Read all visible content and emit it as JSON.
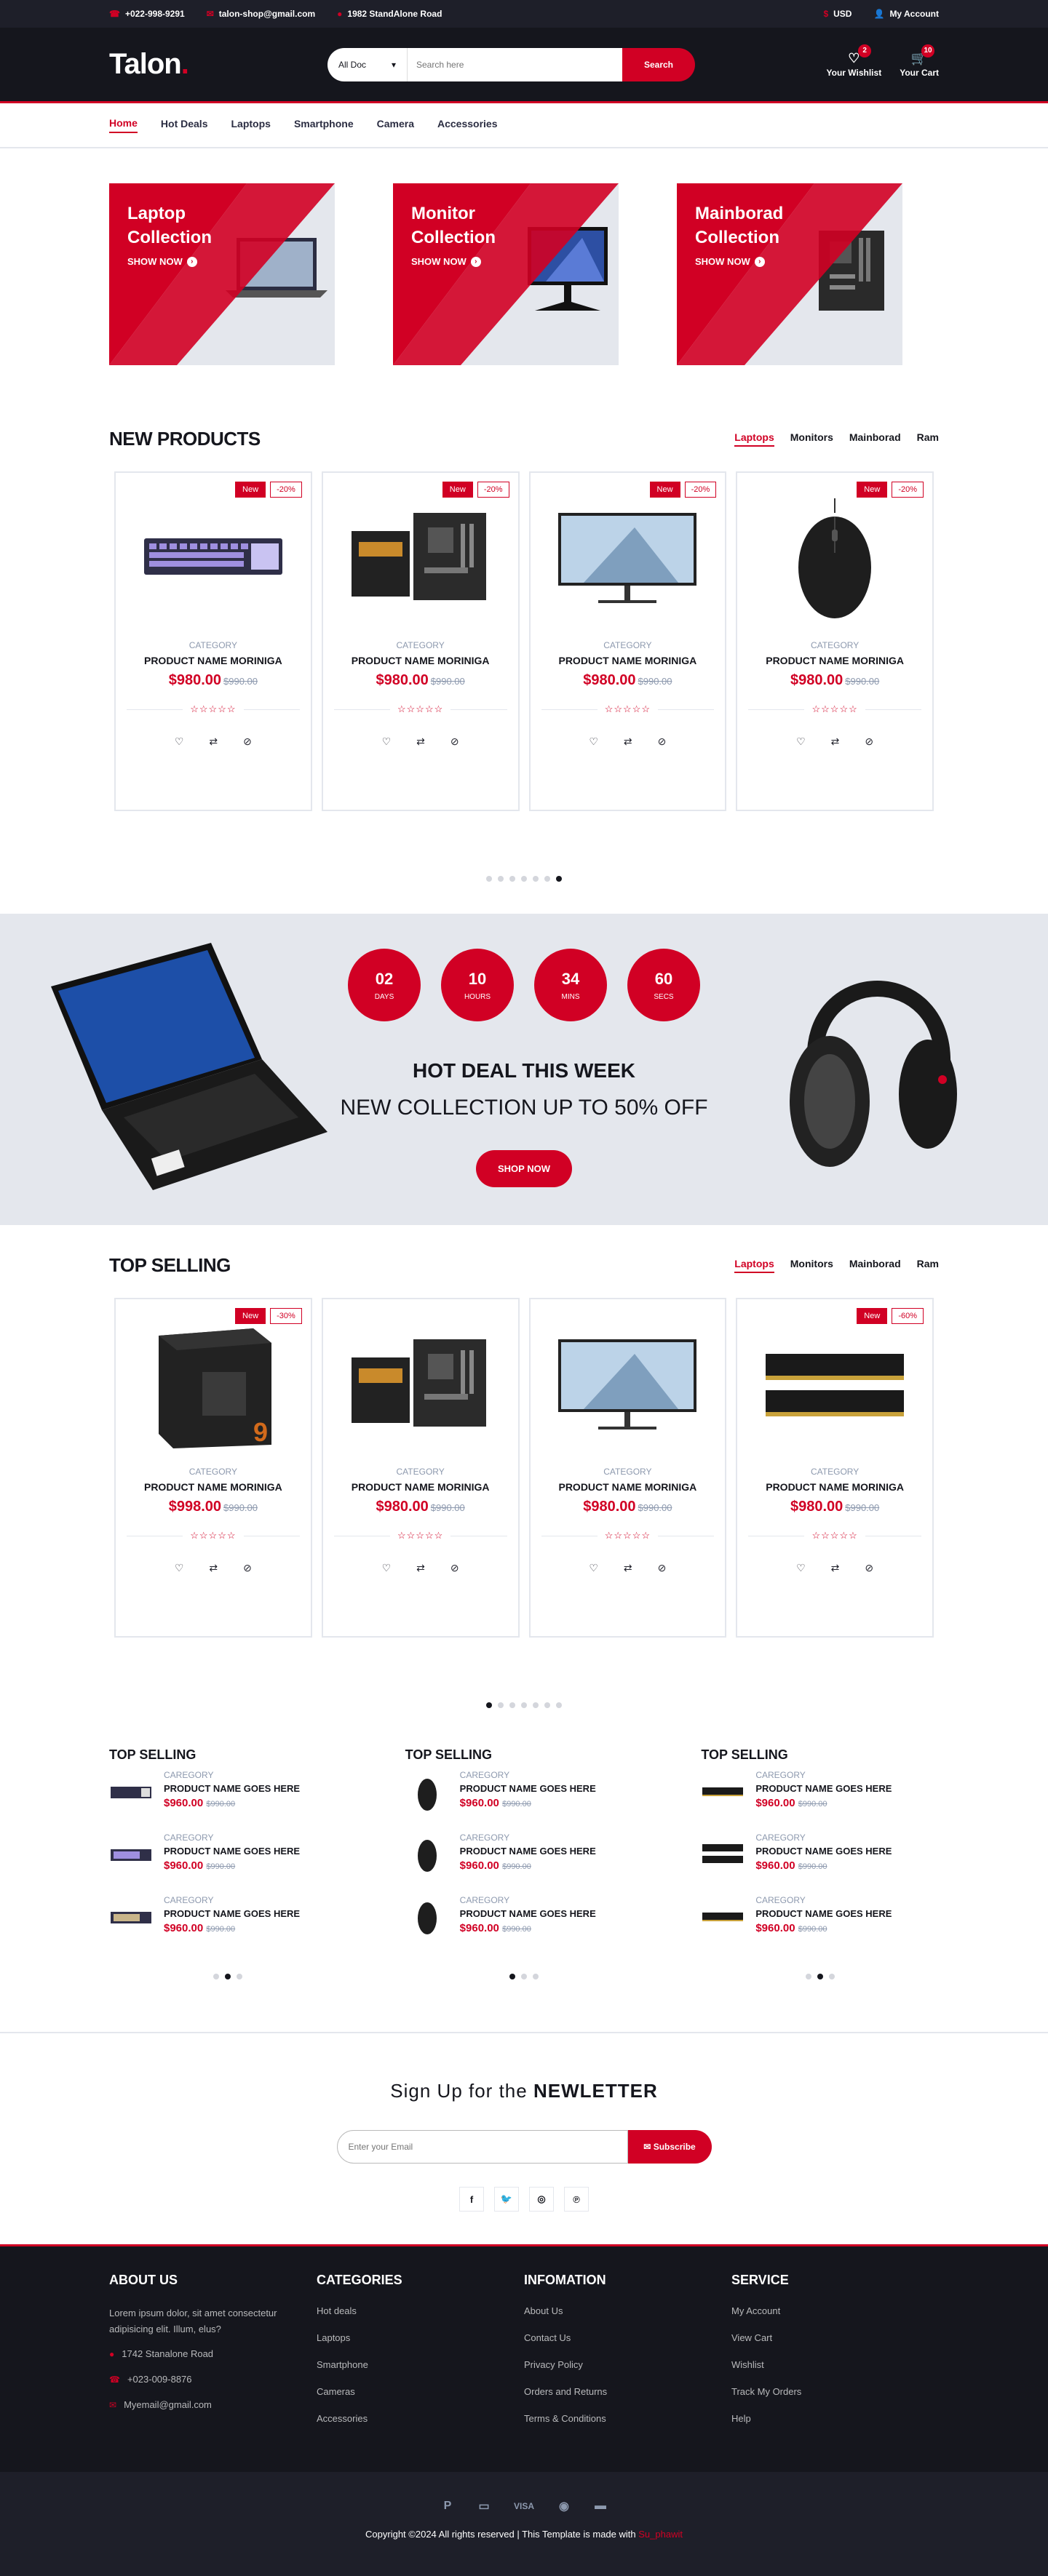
{
  "topbar": {
    "phone": "+022-998-9291",
    "email": "talon-shop@gmail.com",
    "address": "1982 StandAlone Road",
    "currency": "USD",
    "account": "My Account"
  },
  "header": {
    "logo": "Talon",
    "logo_dot": ".",
    "category_select": "All Doc",
    "search_placeholder": "Search here",
    "search_button": "Search",
    "wishlist_label": "Your Wishlist",
    "wishlist_count": "2",
    "cart_label": "Your Cart",
    "cart_count": "10"
  },
  "nav": [
    "Home",
    "Hot Deals",
    "Laptops",
    "Smartphone",
    "Camera",
    "Accessories"
  ],
  "collections": [
    {
      "title": "Laptop Collection",
      "cta": "SHOW NOW"
    },
    {
      "title": "Monitor Collection",
      "cta": "SHOW NOW"
    },
    {
      "title": "Mainborad Collection",
      "cta": "SHOW NOW"
    }
  ],
  "new_products": {
    "title": "NEW PRODUCTS",
    "tabs": [
      "Laptops",
      "Monitors",
      "Mainborad",
      "Ram"
    ],
    "items": [
      {
        "new": "New",
        "sale": "-20%",
        "category": "CATEGORY",
        "name": "PRODUCT NAME MORINIGA",
        "price": "$980.00",
        "old": "$990.00"
      },
      {
        "new": "New",
        "sale": "-20%",
        "category": "CATEGORY",
        "name": "PRODUCT NAME MORINIGA",
        "price": "$980.00",
        "old": "$990.00"
      },
      {
        "new": "New",
        "sale": "-20%",
        "category": "CATEGORY",
        "name": "PRODUCT NAME MORINIGA",
        "price": "$980.00",
        "old": "$990.00"
      },
      {
        "new": "New",
        "sale": "-20%",
        "category": "CATEGORY",
        "name": "PRODUCT NAME MORINIGA",
        "price": "$980.00",
        "old": "$990.00"
      }
    ]
  },
  "hot_deal": {
    "countdown": [
      {
        "value": "02",
        "unit": "DAYS"
      },
      {
        "value": "10",
        "unit": "HOURS"
      },
      {
        "value": "34",
        "unit": "MINS"
      },
      {
        "value": "60",
        "unit": "SECS"
      }
    ],
    "title": "HOT DEAL THIS WEEK",
    "subtitle": "NEW COLLECTION UP TO 50% OFF",
    "button": "SHOP NOW"
  },
  "top_selling": {
    "title": "TOP SELLING",
    "tabs": [
      "Laptops",
      "Monitors",
      "Mainborad",
      "Ram"
    ],
    "items": [
      {
        "new": "New",
        "sale": "-30%",
        "category": "CATEGORY",
        "name": "PRODUCT NAME MORINIGA",
        "price": "$998.00",
        "old": "$990.00"
      },
      {
        "new": "",
        "sale": "",
        "category": "CATEGORY",
        "name": "PRODUCT NAME MORINIGA",
        "price": "$980.00",
        "old": "$990.00"
      },
      {
        "new": "",
        "sale": "",
        "category": "CATEGORY",
        "name": "PRODUCT NAME MORINIGA",
        "price": "$980.00",
        "old": "$990.00"
      },
      {
        "new": "New",
        "sale": "-60%",
        "category": "CATEGORY",
        "name": "PRODUCT NAME MORINIGA",
        "price": "$980.00",
        "old": "$990.00"
      }
    ]
  },
  "widgets": [
    {
      "title": "TOP SELLING",
      "items": [
        {
          "category": "CAREGORY",
          "name": "PRODUCT NAME GOES HERE",
          "price": "$960.00",
          "old": "$990.00"
        },
        {
          "category": "CAREGORY",
          "name": "PRODUCT NAME GOES HERE",
          "price": "$960.00",
          "old": "$990.00"
        },
        {
          "category": "CAREGORY",
          "name": "PRODUCT NAME GOES HERE",
          "price": "$960.00",
          "old": "$990.00"
        }
      ]
    },
    {
      "title": "TOP SELLING",
      "items": [
        {
          "category": "CAREGORY",
          "name": "PRODUCT NAME GOES HERE",
          "price": "$960.00",
          "old": "$990.00"
        },
        {
          "category": "CAREGORY",
          "name": "PRODUCT NAME GOES HERE",
          "price": "$960.00",
          "old": "$990.00"
        },
        {
          "category": "CAREGORY",
          "name": "PRODUCT NAME GOES HERE",
          "price": "$960.00",
          "old": "$990.00"
        }
      ]
    },
    {
      "title": "TOP SELLING",
      "items": [
        {
          "category": "CAREGORY",
          "name": "PRODUCT NAME GOES HERE",
          "price": "$960.00",
          "old": "$990.00"
        },
        {
          "category": "CAREGORY",
          "name": "PRODUCT NAME GOES HERE",
          "price": "$960.00",
          "old": "$990.00"
        },
        {
          "category": "CAREGORY",
          "name": "PRODUCT NAME GOES HERE",
          "price": "$960.00",
          "old": "$990.00"
        }
      ]
    }
  ],
  "newsletter": {
    "title_prefix": "Sign Up for the",
    "title_bold": "NEWLETTER",
    "placeholder": "Enter your Email",
    "button": "Subscribe",
    "socials": [
      "f",
      "t",
      "ig",
      "p"
    ]
  },
  "footer": {
    "about": {
      "title": "ABOUT US",
      "text": "Lorem ipsum dolor, sit amet consectetur adipisicing elit. Illum, elus?",
      "address": "1742 Stanalone Road",
      "phone": "+023-009-8876",
      "email": "Myemail@gmail.com"
    },
    "categories": {
      "title": "CATEGORIES",
      "links": [
        "Hot deals",
        "Laptops",
        "Smartphone",
        "Cameras",
        "Accessories"
      ]
    },
    "information": {
      "title": "INFOMATION",
      "links": [
        "About Us",
        "Contact Us",
        "Privacy Policy",
        "Orders and Returns",
        "Terms & Conditions"
      ]
    },
    "service": {
      "title": "SERVICE",
      "links": [
        "My Account",
        "View Cart",
        "Wishlist",
        "Track My Orders",
        "Help"
      ]
    }
  },
  "bottom": {
    "payments": [
      "paypal-icon",
      "credit-card-icon",
      "VISA",
      "mastercard-icon",
      "card-icon"
    ],
    "copyright": "Copyright ©2024 All rights reserved | This Template is made with",
    "author": "Su_phawit"
  },
  "colors": {
    "accent": "#D10024",
    "dark": "#15161D",
    "darker": "#1E1F29",
    "light_bg": "#E4E7ED"
  }
}
